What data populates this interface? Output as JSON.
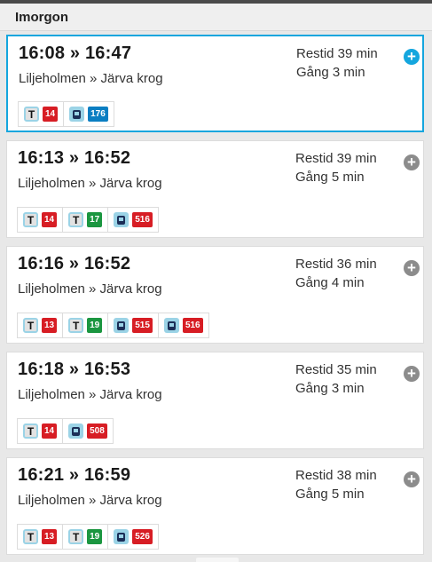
{
  "section": {
    "title": "Imorgon"
  },
  "colors": {
    "accent": "#14a6de",
    "metro_red": "#d71d24",
    "metro_green": "#1b9640",
    "bus_blue": "#0b7ec2",
    "bus_red": "#d71d24",
    "expand_grey": "#8c8c8c"
  },
  "trips": [
    {
      "times": "16:08 » 16:47",
      "route": "Liljeholmen » Järva krog",
      "restid": "Restid 39 min",
      "gang": "Gång 3 min",
      "expand_icon": "plus-circle-icon",
      "selected": true,
      "legs": [
        {
          "mode": "metro",
          "line": "14",
          "color": "#d71d24"
        },
        {
          "mode": "bus",
          "line": "176",
          "color": "#0b7ec2"
        }
      ]
    },
    {
      "times": "16:13 » 16:52",
      "route": "Liljeholmen » Järva krog",
      "restid": "Restid 39 min",
      "gang": "Gång 5 min",
      "expand_icon": "plus-circle-icon",
      "selected": false,
      "legs": [
        {
          "mode": "metro",
          "line": "14",
          "color": "#d71d24"
        },
        {
          "mode": "metro",
          "line": "17",
          "color": "#1b9640"
        },
        {
          "mode": "bus",
          "line": "516",
          "color": "#d71d24"
        }
      ]
    },
    {
      "times": "16:16 » 16:52",
      "route": "Liljeholmen » Järva krog",
      "restid": "Restid 36 min",
      "gang": "Gång 4 min",
      "expand_icon": "plus-circle-icon",
      "selected": false,
      "legs": [
        {
          "mode": "metro",
          "line": "13",
          "color": "#d71d24"
        },
        {
          "mode": "metro",
          "line": "19",
          "color": "#1b9640"
        },
        {
          "mode": "bus",
          "line": "515",
          "color": "#d71d24"
        },
        {
          "mode": "bus",
          "line": "516",
          "color": "#d71d24"
        }
      ]
    },
    {
      "times": "16:18 » 16:53",
      "route": "Liljeholmen » Järva krog",
      "restid": "Restid 35 min",
      "gang": "Gång 3 min",
      "expand_icon": "plus-circle-icon",
      "selected": false,
      "legs": [
        {
          "mode": "metro",
          "line": "14",
          "color": "#d71d24"
        },
        {
          "mode": "bus",
          "line": "508",
          "color": "#d71d24"
        }
      ]
    },
    {
      "times": "16:21 » 16:59",
      "route": "Liljeholmen » Järva krog",
      "restid": "Restid 38 min",
      "gang": "Gång 5 min",
      "expand_icon": "plus-circle-icon",
      "selected": false,
      "legs": [
        {
          "mode": "metro",
          "line": "13",
          "color": "#d71d24"
        },
        {
          "mode": "metro",
          "line": "19",
          "color": "#1b9640"
        },
        {
          "mode": "bus",
          "line": "526",
          "color": "#d71d24"
        }
      ]
    }
  ]
}
